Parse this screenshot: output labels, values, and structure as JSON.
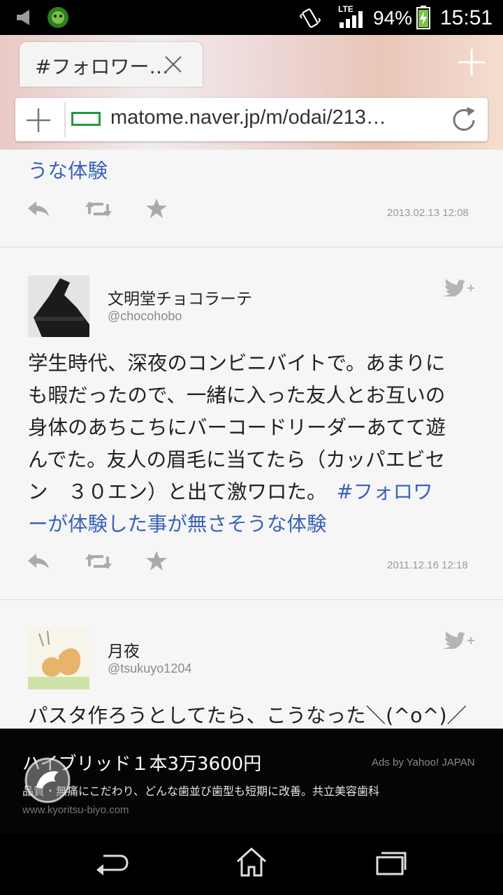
{
  "status_bar": {
    "battery": "94%",
    "time": "15:51",
    "network": "LTE"
  },
  "browser": {
    "tab_title": "#フォロワー…",
    "url": "matome.naver.jp/m/odai/213…"
  },
  "feed": {
    "partial_top": {
      "text": "うな体験",
      "date": "2013.02.13 12:08"
    },
    "tweets": [
      {
        "display_name": "文明堂チョコラーテ",
        "handle": "@chocohobo",
        "text_lines": [
          "学生時代、深夜のコンビニバイトで。あまりに",
          "も暇だったので、一緒に入った友人とお互いの",
          "身体のあちこちにバーコードリーダーあてて遊",
          "んでた。友人の眉毛に当てたら（カッパエビセ"
        ],
        "text_line5": "ン　３０エン）と出て激ワロた。　",
        "hashtag_part1": "#フォロワ",
        "hashtag_part2": "ーが体験した事が無さそうな体験",
        "date": "2011.12.16 12:18"
      },
      {
        "display_name": "月夜",
        "handle": "@tsukuyo1204",
        "text": "パスタ作ろうとしてたら、こうなった＼(^o^)／"
      }
    ]
  },
  "ad": {
    "title": "ハイブリッド１本3万3600円",
    "attribution": "Ads by Yahoo! JAPAN",
    "description": "品質・無痛にこだわり、どんな歯並び歯型も短期に改善。共立美容歯科",
    "url": "www.kyoritsu-biyo.com"
  },
  "icons": [
    "reply-icon",
    "retweet-icon",
    "favorite-icon",
    "twitter-follow-icon",
    "back-icon",
    "home-icon",
    "recent-apps-icon",
    "refresh-icon",
    "new-tab-icon",
    "close-icon"
  ]
}
